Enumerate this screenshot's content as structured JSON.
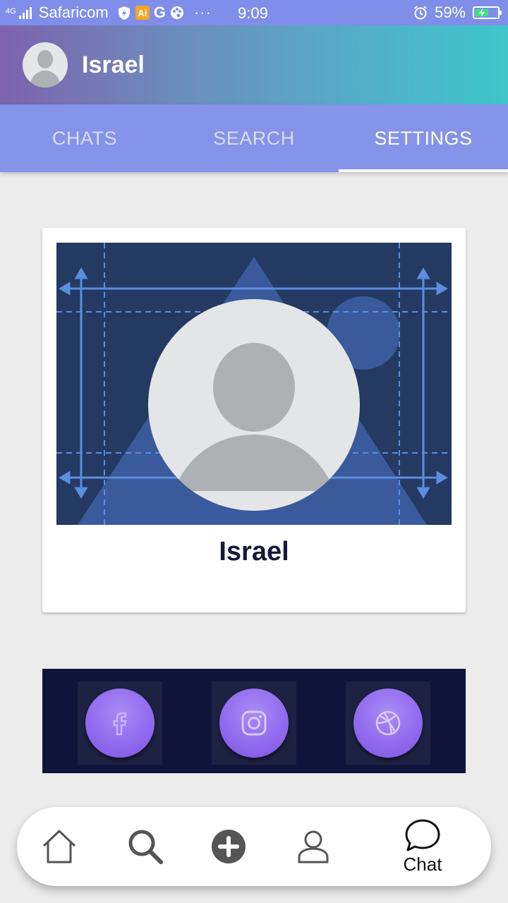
{
  "status_bar": {
    "network_type": "4G",
    "carrier": "Safaricom",
    "app_badge": "Ai",
    "g_letter": "G",
    "more": "···",
    "time": "9:09",
    "battery_percent": "59%",
    "battery_level": 0.59
  },
  "header": {
    "username": "Israel",
    "avatar_icon": "user-avatar-icon"
  },
  "tabs": [
    {
      "label": "CHATS",
      "active": false
    },
    {
      "label": "SEARCH",
      "active": false
    },
    {
      "label": "SETTINGS",
      "active": true
    }
  ],
  "profile": {
    "name": "Israel",
    "cover_icon": "blueprint-cover",
    "avatar_icon": "user-avatar-icon"
  },
  "social": {
    "items": [
      {
        "name": "facebook",
        "icon": "facebook-icon"
      },
      {
        "name": "instagram",
        "icon": "instagram-icon"
      },
      {
        "name": "dribbble",
        "icon": "dribbble-icon"
      }
    ]
  },
  "bottom_nav": {
    "items": [
      {
        "icon": "home-icon",
        "label": ""
      },
      {
        "icon": "search-icon",
        "label": ""
      },
      {
        "icon": "add-icon",
        "label": ""
      },
      {
        "icon": "profile-icon",
        "label": ""
      },
      {
        "icon": "chat-bubble-icon",
        "label": "Chat"
      }
    ]
  },
  "colors": {
    "status_bar": "#7f8ee8",
    "tabs_bg": "#8593e9",
    "header_gradient_start": "#7d63ad",
    "header_gradient_end": "#3fc6cb",
    "background": "#ececec",
    "social_bg": "#10143a",
    "social_circle": "#8b63ec",
    "name_text": "#141a3b"
  }
}
